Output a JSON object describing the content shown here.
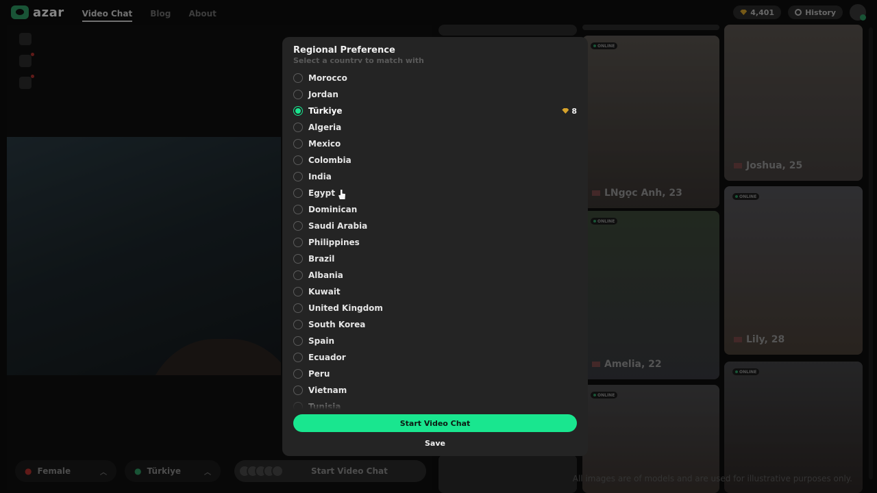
{
  "header": {
    "logo_text": "azar",
    "nav": [
      "Video Chat",
      "Blog",
      "About"
    ],
    "gems": "4,401",
    "history_label": "History"
  },
  "filters": {
    "gender": "Female",
    "country": "Türkiye",
    "start_label": "Start Video Chat"
  },
  "cards": [
    {
      "online": "ONLINE",
      "name": "LNgọc Anh, 23"
    },
    {
      "online": "",
      "name": "Joshua, 25"
    },
    {
      "online": "ONLINE",
      "name": "Amelia, 22"
    },
    {
      "online": "ONLINE",
      "name": "Lily, 28"
    },
    {
      "online": "ONLINE",
      "name": ""
    },
    {
      "online": "ONLINE",
      "name": ""
    }
  ],
  "disclaimer": "All images are of models and are used for illustrative purposes only.",
  "modal": {
    "title": "Regional Preference",
    "subtitle": "Select a country to match with",
    "countries": [
      "Morocco",
      "Jordan",
      "Türkiye",
      "Algeria",
      "Mexico",
      "Colombia",
      "India",
      "Egypt",
      "Dominican",
      "Saudi Arabia",
      "Philippines",
      "Brazil",
      "Albania",
      "Kuwait",
      "United Kingdom",
      "South Korea",
      "Spain",
      "Ecuador",
      "Peru",
      "Vietnam",
      "Tunisia"
    ],
    "selected": "Türkiye",
    "selected_cost": "8",
    "start_button": "Start Video Chat",
    "save_button": "Save"
  },
  "colors": {
    "accent": "#19e68f",
    "gem": "#d6a22b",
    "modal_bg": "#242424"
  }
}
